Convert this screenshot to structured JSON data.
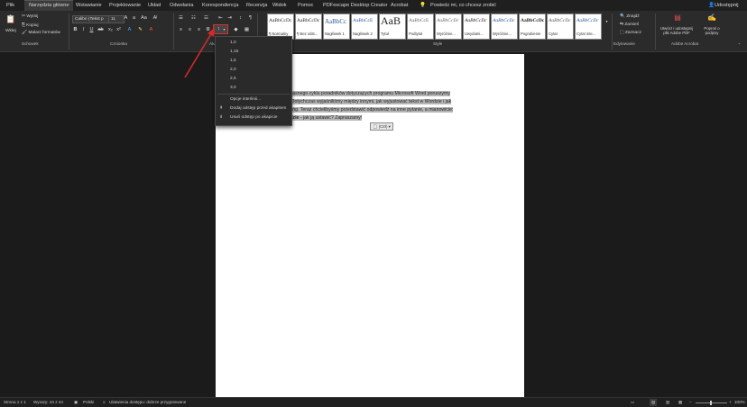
{
  "tabs": [
    "Plik",
    "Narzędzia główne",
    "Wstawianie",
    "Projektowanie",
    "Układ",
    "Odwołania",
    "Korespondencja",
    "Recenzja",
    "Widok",
    "Pomoc",
    "PDFescape Desktop Creator",
    "Acrobat"
  ],
  "tell_me": "Powiedz mi, co chcesz zrobić",
  "share_label": "Udostępnij",
  "clipboard": {
    "paste": "Wklej",
    "cut": "Wytnij",
    "copy": "Kopiuj",
    "format_painter": "Malarz formatów",
    "label": "Schowek"
  },
  "font": {
    "name": "Calibri (Tekst p",
    "size": "11",
    "label": "Czcionka"
  },
  "paragraph_label": "Akapit",
  "styles": {
    "label": "Style",
    "items": [
      {
        "preview": "AaBbCcDc",
        "name": "¶ Normalny"
      },
      {
        "preview": "AaBbCcDc",
        "name": "¶ Bez odst..."
      },
      {
        "preview": "AaBbCc",
        "name": "Nagłówek 1"
      },
      {
        "preview": "AaBbCcE",
        "name": "Nagłówek 2"
      },
      {
        "preview": "AaB",
        "name": "Tytuł"
      },
      {
        "preview": "AaBbCcE",
        "name": "Podtytuł"
      },
      {
        "preview": "AaBbCcDc",
        "name": "Wyróżnie..."
      },
      {
        "preview": "AaBbCcDc",
        "name": "Uwydatni..."
      },
      {
        "preview": "AaBbCcDc",
        "name": "Wyróżnie..."
      },
      {
        "preview": "AaBbCcDc",
        "name": "Pogrubienie"
      },
      {
        "preview": "AaBbCcDc",
        "name": "Cytat"
      },
      {
        "preview": "AaBbCcDc",
        "name": "Cytat inte..."
      }
    ]
  },
  "editing": {
    "find": "Znajdź",
    "replace": "Zamień",
    "select": "Zaznacz",
    "label": "Edytowanie"
  },
  "acrobat": {
    "create": "Utwórz i udostępnij plik Adobe PDF",
    "sign": "Poproś o podpisy",
    "label": "Adobe Acrobat"
  },
  "line_spacing_menu": {
    "options": [
      "1,0",
      "1,15",
      "1,5",
      "2,0",
      "2,5",
      "3,0"
    ],
    "line_options": "Opcje interlinii...",
    "add_before": "Dodaj odstęp przed akapitem",
    "remove_after": "Usuń odstęp po akapicie"
  },
  "document": {
    "line1": "...nasnego cyklu poradników dotyczących programu Microsoft Word poruszymy",
    "line2": "... Dotychczas wyjaśniliśmy między innymi, jak wyjustować tekst w Wordzie i jak",
    "line3": "...ong. Teraz chcielibyśmy przedstawić odpowiedź na inne pytanie, a mianowicie:",
    "line4_bold": "...dzie",
    "line4_rest": " - jak ją ustawić? Zapraszamy!",
    "paste_tag": "(Ctrl) ▾"
  },
  "status": {
    "page": "Strona 1 z 1",
    "words": "Wyrazy: 44 z 44",
    "language": "Polski",
    "accessibility": "Ułatwienia dostępu: dobrze przygotowane",
    "zoom": "100%"
  },
  "colors": {
    "accent": "#2b579a",
    "highlight_box": "#e03131",
    "arrow": "#d42a2a"
  }
}
